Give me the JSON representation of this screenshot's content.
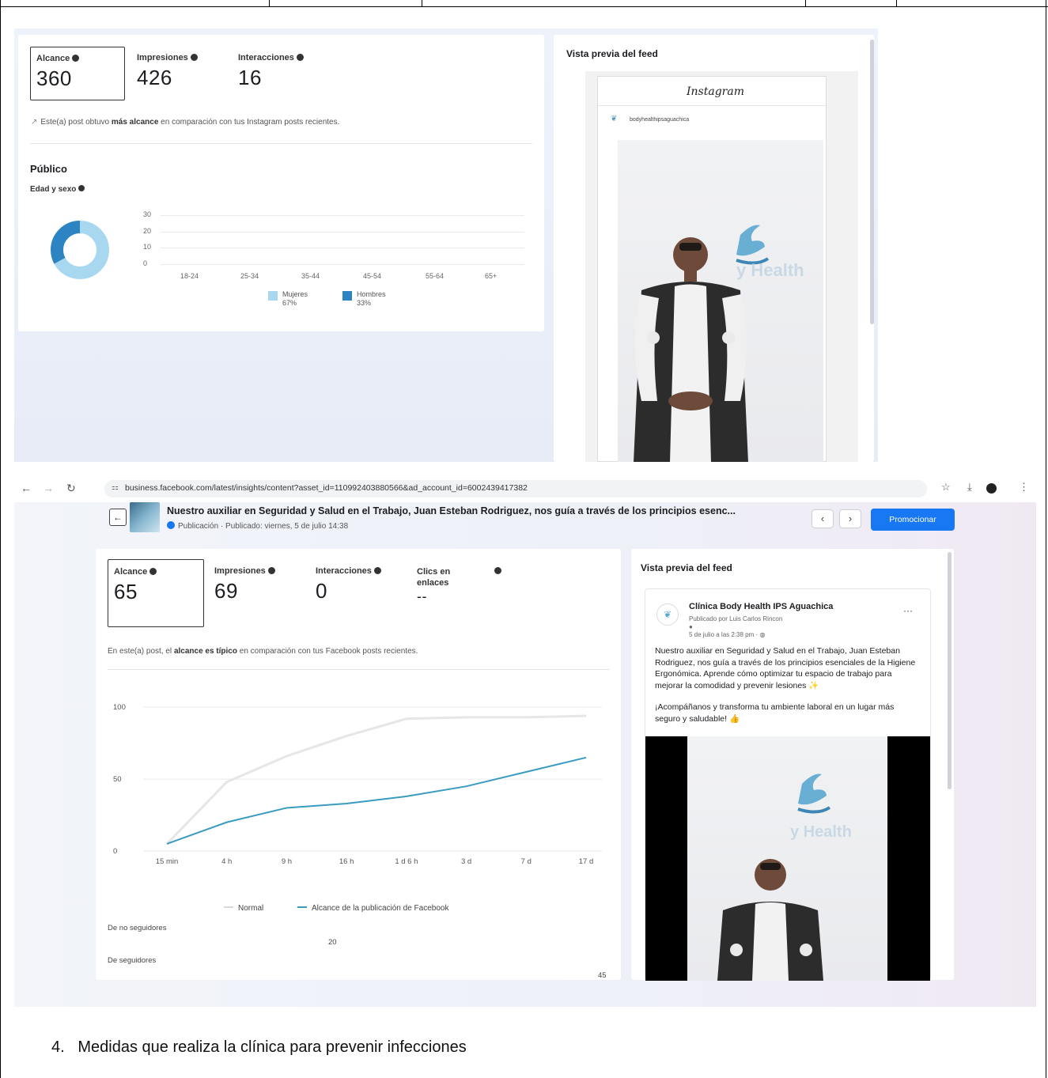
{
  "shot1": {
    "metrics": [
      {
        "label": "Alcance",
        "value": "360"
      },
      {
        "label": "Impresiones",
        "value": "426"
      },
      {
        "label": "Interacciones",
        "value": "16"
      }
    ],
    "note_prefix": "Este(a) post obtuvo ",
    "note_bold": "más alcance",
    "note_suffix": " en comparación con tus Instagram posts recientes.",
    "public_heading": "Público",
    "age_sex_label": "Edad y sexo",
    "chart_data": {
      "type": "bar",
      "categories": [
        "18-24",
        "25-34",
        "35-44",
        "45-54",
        "55-64",
        "65+"
      ],
      "y_ticks": [
        "30",
        "20",
        "10",
        "0"
      ],
      "ylim": [
        0,
        30
      ],
      "series": [
        {
          "name": "Mujeres",
          "share": "67%",
          "color": "#a8d8f0"
        },
        {
          "name": "Hombres",
          "share": "33%",
          "color": "#2d84c3"
        }
      ],
      "donut": [
        0.67,
        0.33
      ]
    },
    "preview_title": "Vista previa del feed",
    "instagram_logo": "Instagram",
    "ig_handle": "bodyhealthipsaguachica",
    "photo_brand": "y Health"
  },
  "shot2": {
    "url": "business.facebook.com/latest/insights/content?asset_id=110992403880566&ad_account_id=6002439417382",
    "post_title": "Nuestro auxiliar en Seguridad y Salud en el Trabajo, Juan Esteban Rodriguez, nos guía a través de los principios esenc...",
    "post_meta": "Publicación · Publicado: viernes, 5 de julio 14:38",
    "promote_label": "Promocionar",
    "metrics": [
      {
        "label": "Alcance",
        "value": "65"
      },
      {
        "label": "Impresiones",
        "value": "69"
      },
      {
        "label": "Interacciones",
        "value": "0"
      },
      {
        "label": "Clics en enlaces",
        "value": "--"
      }
    ],
    "note_prefix": "En este(a) post, el ",
    "note_bold": "alcance es típico",
    "note_suffix": " en comparación con tus Facebook posts recientes.",
    "chart_data": {
      "type": "line",
      "x": [
        "15 min",
        "4 h",
        "9 h",
        "16 h",
        "1 d 6 h",
        "3 d",
        "7 d",
        "17 d"
      ],
      "y_ticks": [
        "100",
        "50",
        "0"
      ],
      "ylim": [
        0,
        110
      ],
      "series": [
        {
          "name": "Normal",
          "color": "#e6e6e6",
          "values": [
            5,
            48,
            66,
            80,
            92,
            93,
            93,
            94
          ]
        },
        {
          "name": "Alcance de la publicación de Facebook",
          "color": "#3a9bc1",
          "values": [
            5,
            20,
            30,
            33,
            38,
            45,
            55,
            65
          ]
        }
      ]
    },
    "followers": [
      {
        "label": "De no seguidores",
        "value": "20"
      },
      {
        "label": "De seguidores",
        "value": "45"
      }
    ],
    "preview_title": "Vista previa del feed",
    "fb_page_name": "Clínica Body Health IPS Aguachica",
    "fb_published_by": "Publicado por Luis Carlos Rincon",
    "fb_date": "5 de julio a las 2:38 pm · ",
    "fb_text_1": "Nuestro auxiliar en Seguridad y Salud en el Trabajo, Juan Esteban Rodriguez, nos guía a través de los principios esenciales de la Higiene Ergonómica. Aprende cómo optimizar tu espacio de trabajo para mejorar la comodidad y prevenir lesiones",
    "fb_text_2": "¡Acompáñanos y transforma tu ambiente laboral en un lugar más seguro y saludable!",
    "photo_brand": "y Health",
    "more_icon": "···"
  },
  "heading_number": "4.",
  "heading_text": "Medidas que realiza la clínica para prevenir infecciones"
}
